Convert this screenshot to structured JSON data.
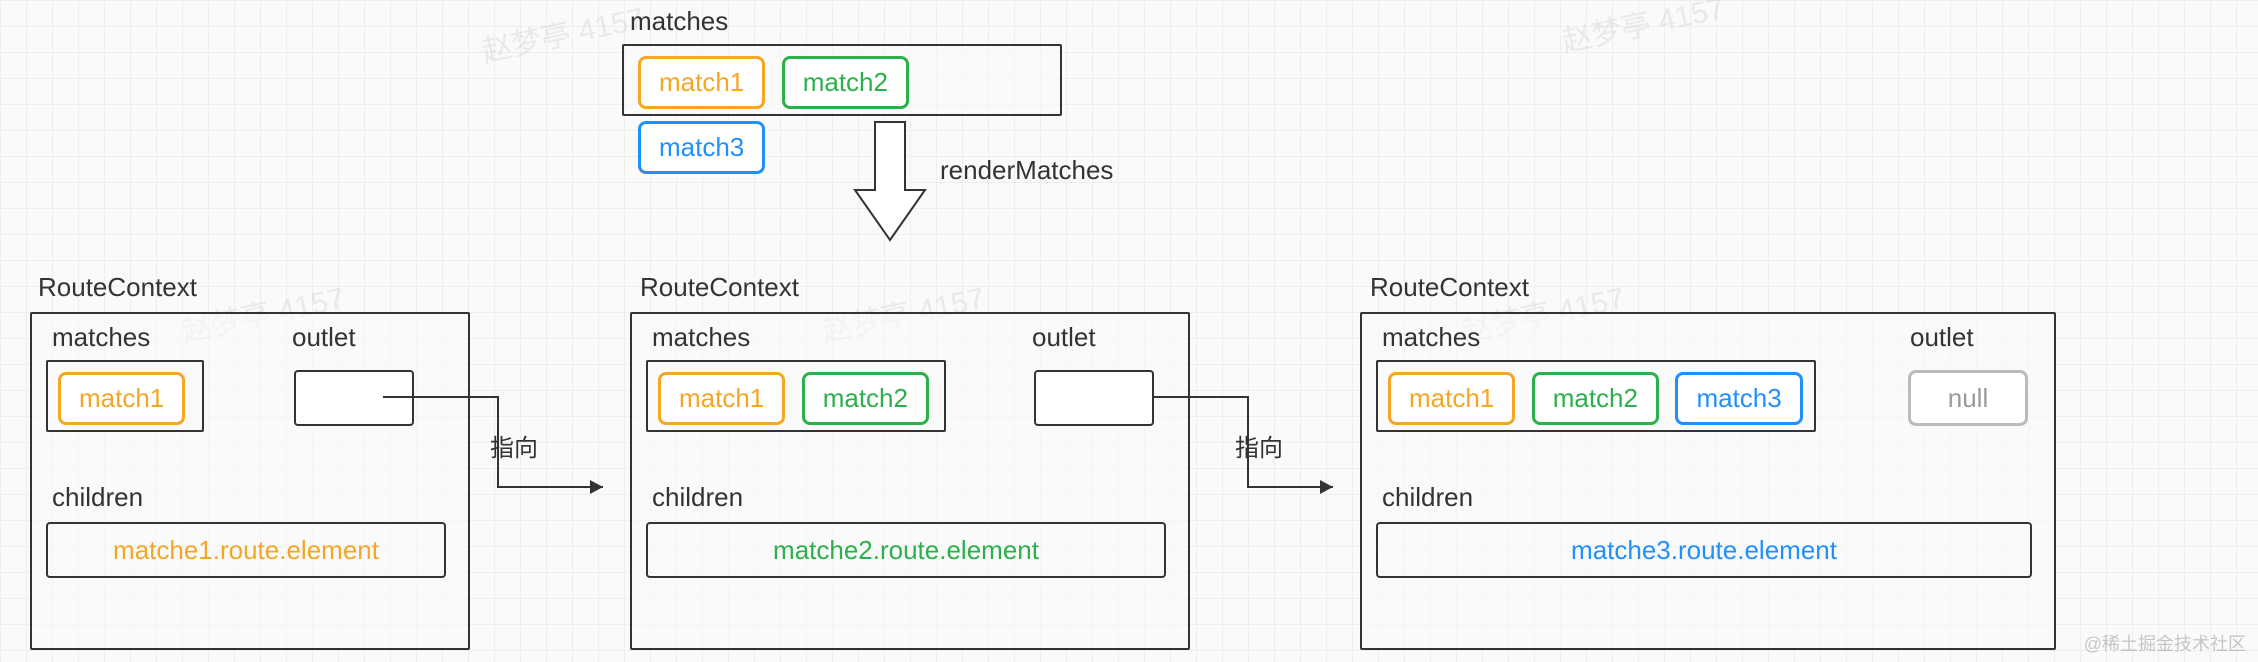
{
  "top": {
    "label": "matches",
    "items": [
      {
        "text": "match1",
        "color": "orange"
      },
      {
        "text": "match2",
        "color": "green"
      },
      {
        "text": "match3",
        "color": "blue"
      }
    ],
    "arrowLabel": "renderMatches"
  },
  "contexts": [
    {
      "title": "RouteContext",
      "matchesLabel": "matches",
      "outletLabel": "outlet",
      "matches": [
        {
          "text": "match1",
          "color": "orange"
        }
      ],
      "outletContent": "",
      "childrenLabel": "children",
      "childrenText": "matche1.route.element",
      "childrenColor": "orange",
      "pointerLabel": "指向"
    },
    {
      "title": "RouteContext",
      "matchesLabel": "matches",
      "outletLabel": "outlet",
      "matches": [
        {
          "text": "match1",
          "color": "orange"
        },
        {
          "text": "match2",
          "color": "green"
        }
      ],
      "outletContent": "",
      "childrenLabel": "children",
      "childrenText": "matche2.route.element",
      "childrenColor": "green",
      "pointerLabel": "指向"
    },
    {
      "title": "RouteContext",
      "matchesLabel": "matches",
      "outletLabel": "outlet",
      "matches": [
        {
          "text": "match1",
          "color": "orange"
        },
        {
          "text": "match2",
          "color": "green"
        },
        {
          "text": "match3",
          "color": "blue"
        }
      ],
      "outletContent": "null",
      "childrenLabel": "children",
      "childrenText": "matche3.route.element",
      "childrenColor": "blue",
      "pointerLabel": ""
    }
  ],
  "watermarks": {
    "text": "赵梦亭 4157",
    "footer": "@稀土掘金技术社区"
  }
}
